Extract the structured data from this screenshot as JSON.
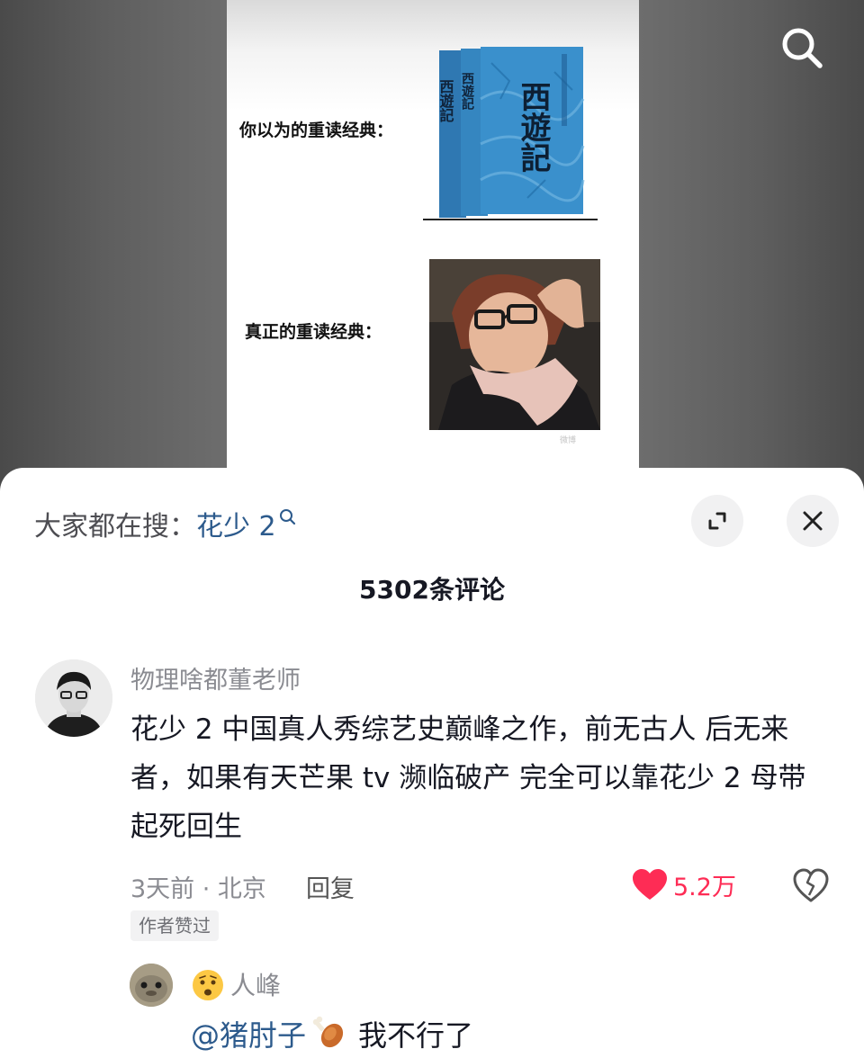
{
  "meme": {
    "label_expected": "你以为的重读经典：",
    "label_real": "真正的重读经典：",
    "book_title": "西遊記",
    "watermark": "微博"
  },
  "top_icons": {
    "search": "search-icon"
  },
  "sheet": {
    "search_prefix": "大家都在搜：",
    "search_term": "花少 2",
    "comment_count": "5302条评论",
    "icons": {
      "expand": "expand-icon",
      "close": "close-icon"
    }
  },
  "comment": {
    "username": "物理啥都董老师",
    "text": "花少 2 中国真人秀综艺史巅峰之作，前无古人 后无来者，如果有天芒果 tv 濒临破产 完全可以靠花少 2 母带起死回生",
    "time_location": "3天前 · 北京",
    "reply_label": "回复",
    "like_count": "5.2万",
    "author_badge": "作者赞过"
  },
  "reply": {
    "username": "人峰",
    "mention": "@猪肘子",
    "text": "我不行了"
  },
  "colors": {
    "accent_red": "#fe2c55",
    "link_blue": "#2c5a8c",
    "book_blue": "#2f87c4"
  }
}
